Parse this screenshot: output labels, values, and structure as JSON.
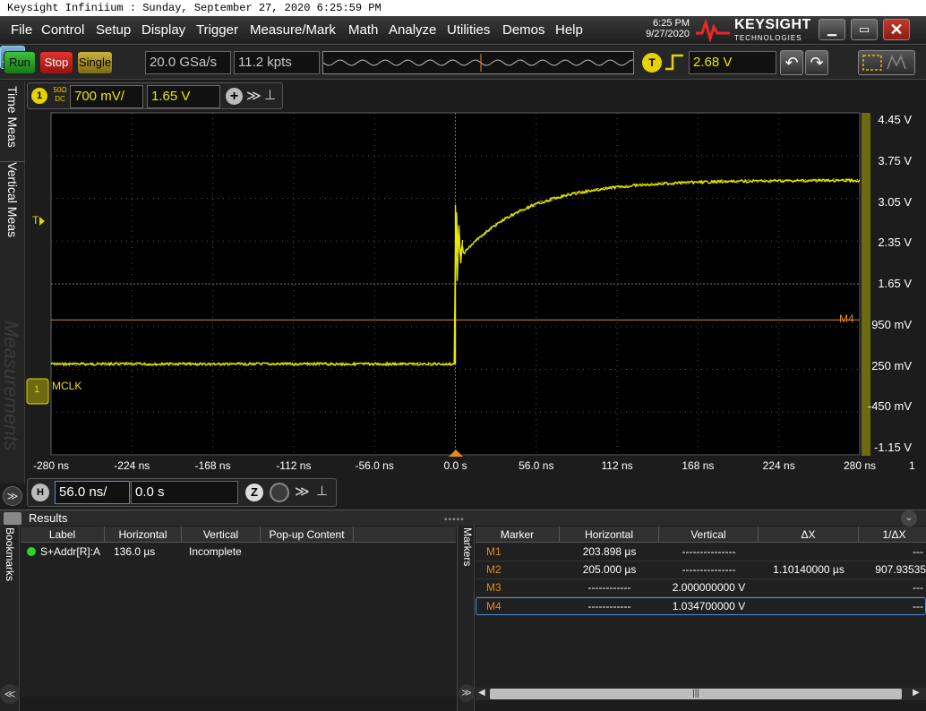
{
  "window": {
    "title": "Keysight Infiniium : Sunday, September 27, 2020 6:25:59 PM"
  },
  "menu": [
    {
      "label": "File"
    },
    {
      "label": "Control"
    },
    {
      "label": "Setup"
    },
    {
      "label": "Display"
    },
    {
      "label": "Trigger"
    },
    {
      "label": "Measure/Mark"
    },
    {
      "label": "Math"
    },
    {
      "label": "Analyze"
    },
    {
      "label": "Utilities"
    },
    {
      "label": "Demos"
    },
    {
      "label": "Help"
    }
  ],
  "clock": {
    "time": "6:25 PM",
    "date": "9/27/2020"
  },
  "brand": {
    "name": "KEYSIGHT",
    "sub": "TECHNOLOGIES",
    "color": "#e8292c"
  },
  "toolbar": {
    "run_label": "Run",
    "stop_label": "Stop",
    "single_label": "Single",
    "sample_rate": "20.0 GSa/s",
    "memory_depth": "11.2 kpts",
    "trigger_badge": "T",
    "trigger_level": "2.68 V"
  },
  "channel": {
    "number": "1",
    "impedance": "50Ω",
    "coupling": "DC",
    "scale": "700 mV/",
    "offset": "1.65 V",
    "color": "#e8e800"
  },
  "side_tabs": {
    "time_meas": "Time Meas",
    "vertical_meas": "Vertical Meas",
    "measurements": "Measurements"
  },
  "graticule": {
    "trigger_marker": "T",
    "marker_label": "M4",
    "channel_label": "MCLK",
    "ground_label": "1",
    "v_labels": [
      "4.45 V",
      "3.75 V",
      "3.05 V",
      "2.35 V",
      "1.65 V",
      "950 mV",
      "250 mV",
      "-450 mV",
      "-1.15 V"
    ],
    "h_labels": [
      "-280 ns",
      "-224 ns",
      "-168 ns",
      "-112 ns",
      "-56.0 ns",
      "0.0 s",
      "56.0 ns",
      "112 ns",
      "168 ns",
      "224 ns",
      "280 ns"
    ],
    "h_label_extra": "1"
  },
  "horizontal": {
    "badge": "H",
    "scale": "56.0 ns/",
    "position": "0.0 s"
  },
  "results": {
    "title": "Results",
    "columns": [
      "Label",
      "Horizontal",
      "Vertical",
      "Pop-up Content"
    ],
    "rows": [
      {
        "label": "S+Addr[R]:A",
        "horizontal": "136.0 µs",
        "vertical": "Incomplete",
        "popup": ""
      }
    ]
  },
  "bookmarks_tab": "Bookmarks",
  "markers_tab": "Markers",
  "markers": {
    "columns": [
      "Marker",
      "Horizontal",
      "Vertical",
      "ΔX",
      "1/ΔX"
    ],
    "rows": [
      {
        "name": "M1",
        "horizontal": "203.898 µs",
        "vertical": "---------------",
        "dx": "",
        "inv_dx": "---"
      },
      {
        "name": "M2",
        "horizontal": "205.000 µs",
        "vertical": "---------------",
        "dx": "1.10140000 µs",
        "inv_dx": "907.93535"
      },
      {
        "name": "M3",
        "horizontal": "------------",
        "vertical": "2.000000000 V",
        "dx": "",
        "inv_dx": "---"
      },
      {
        "name": "M4",
        "horizontal": "------------",
        "vertical": "1.034700000 V",
        "dx": "",
        "inv_dx": "---"
      }
    ]
  },
  "scroll": {
    "thumb": "|||"
  },
  "waveform": {
    "initial_level_v": 0.28,
    "final_level_v": 3.42,
    "edge_time_ns": 0,
    "peak_v": 3.0,
    "marker_m4_v": 1.0347
  }
}
